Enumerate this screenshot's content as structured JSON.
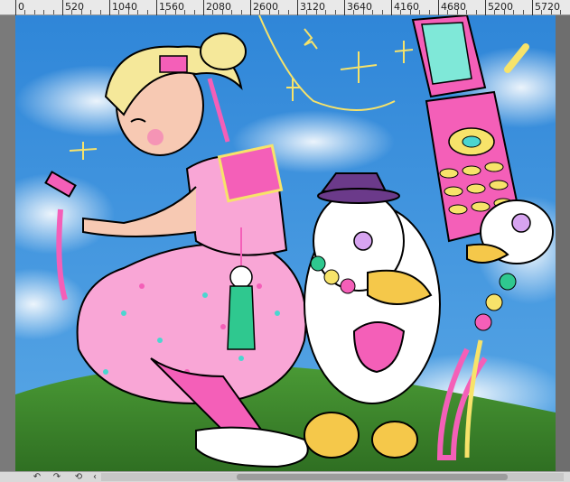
{
  "ruler": {
    "labels": [
      "0",
      "520",
      "1040",
      "1560",
      "2080",
      "2600",
      "3120",
      "3640",
      "4160",
      "4680",
      "5200",
      "5720"
    ]
  },
  "bottom_bar": {
    "icons": [
      "rotate-left-icon",
      "rotate-right-icon",
      "reset-rotation-icon",
      "scroll-left-icon"
    ]
  },
  "colors": {
    "sky": "#3f8fd6",
    "grass": "#3f8a2f",
    "pink": "#f45fb8",
    "yellow": "#f7e36a",
    "ruler_bg": "#e9e9e9"
  }
}
